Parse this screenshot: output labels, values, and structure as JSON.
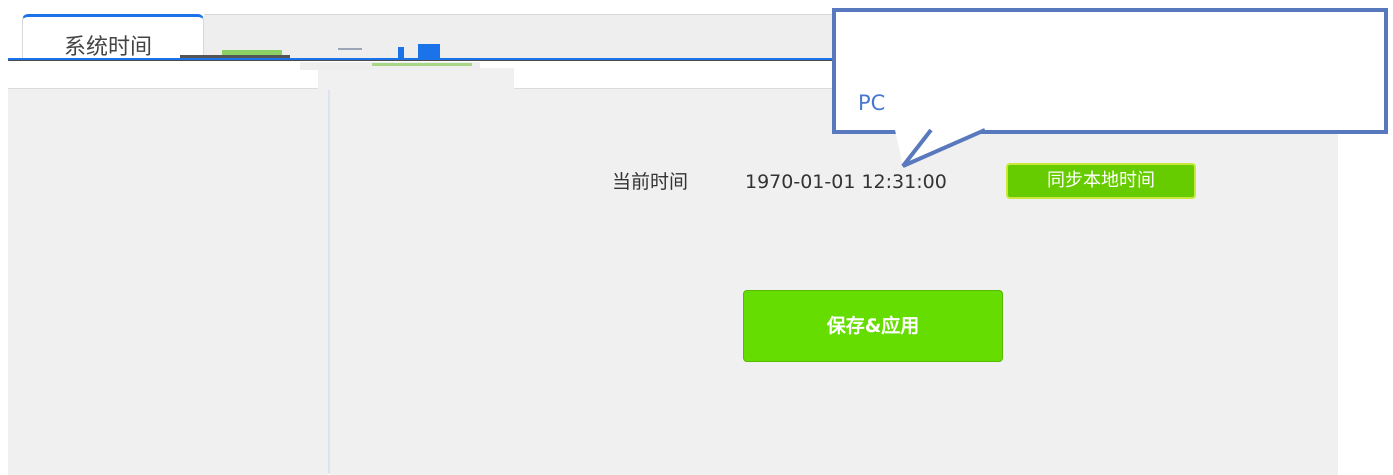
{
  "tabs": {
    "active_label": "系统时间"
  },
  "time": {
    "label": "当前时间",
    "value": "1970-01-01 12:31:00",
    "sync_button_label": "同步本地时间"
  },
  "actions": {
    "save_button_label": "保存&应用"
  },
  "callout": {
    "text": "PC"
  },
  "colors": {
    "accent_blue": "#1a73e8",
    "button_green": "#66dd00",
    "callout_border": "#5879bd",
    "callout_text": "#4a78d0"
  }
}
